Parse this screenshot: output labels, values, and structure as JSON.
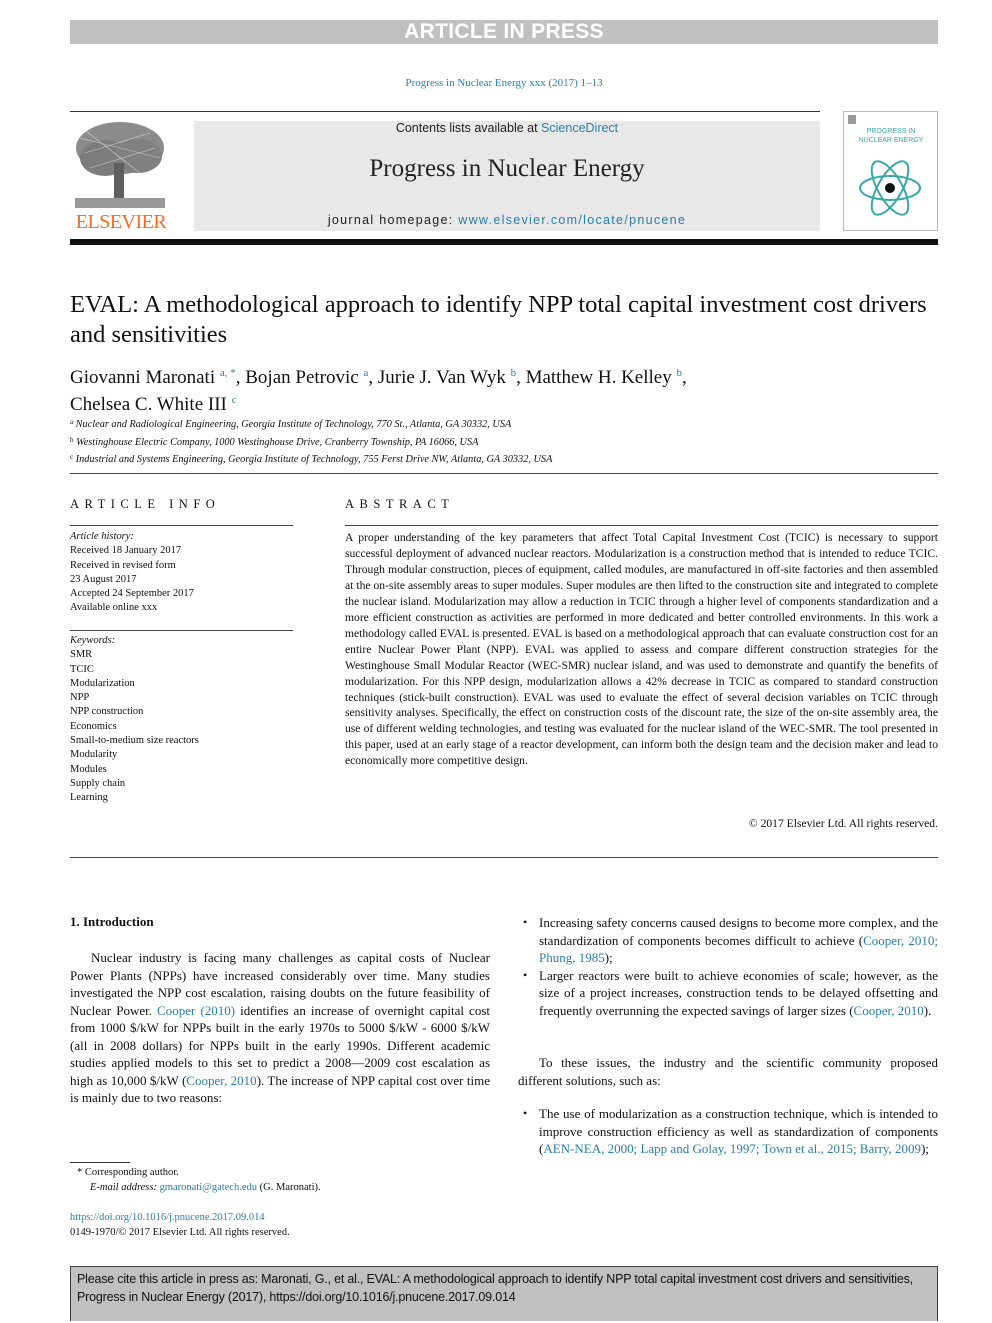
{
  "banner": {
    "article_in_press": "ARTICLE IN PRESS"
  },
  "journal_ref": "Progress in Nuclear Energy xxx (2017) 1–13",
  "header": {
    "publisher_logo_text": "ELSEVIER",
    "contents_prefix": "Contents lists available at ",
    "contents_link": "ScienceDirect",
    "journal_name": "Progress in Nuclear Energy",
    "homepage_prefix": "journal homepage: ",
    "homepage_link": "www.elsevier.com/locate/pnucene",
    "cover_title_line1": "PROGRESS IN",
    "cover_title_line2": "NUCLEAR ENERGY"
  },
  "article": {
    "title": "EVAL: A methodological approach to identify NPP total capital investment cost drivers and sensitivities",
    "authors": [
      {
        "name": "Giovanni Maronati",
        "sup": "a, *",
        "sep": ", "
      },
      {
        "name": "Bojan Petrovic",
        "sup": "a",
        "sep": ", "
      },
      {
        "name": "Jurie J. Van Wyk",
        "sup": "b",
        "sep": ", "
      },
      {
        "name": "Matthew H. Kelley",
        "sup": "b",
        "sep": ","
      },
      {
        "name": "Chelsea C. White III",
        "sup": "c",
        "sep": ""
      }
    ],
    "affiliations": [
      {
        "key": "a",
        "text": "Nuclear and Radiological Engineering, Georgia Institute of Technology, 770 St., Atlanta, GA 30332, USA"
      },
      {
        "key": "b",
        "text": "Westinghouse Electric Company, 1000 Westinghouse Drive, Cranberry Township, PA 16066, USA"
      },
      {
        "key": "c",
        "text": "Industrial and Systems Engineering, Georgia Institute of Technology, 755 Ferst Drive NW, Atlanta, GA 30332, USA"
      }
    ]
  },
  "article_info": {
    "heading": "ARTICLE INFO",
    "history_label": "Article history:",
    "history": [
      "Received 18 January 2017",
      "Received in revised form",
      "23 August 2017",
      "Accepted 24 September 2017",
      "Available online xxx"
    ],
    "keywords_label": "Keywords:",
    "keywords": [
      "SMR",
      "TCIC",
      "Modularization",
      "NPP",
      "NPP construction",
      "Economics",
      "Small-to-medium size reactors",
      "Modularity",
      "Modules",
      "Supply chain",
      "Learning"
    ]
  },
  "abstract": {
    "heading": "ABSTRACT",
    "text": "A proper understanding of the key parameters that affect Total Capital Investment Cost (TCIC) is necessary to support successful deployment of advanced nuclear reactors. Modularization is a construction method that is intended to reduce TCIC. Through modular construction, pieces of equipment, called modules, are manufactured in off-site factories and then assembled at the on-site assembly areas to super modules. Super modules are then lifted to the construction site and integrated to complete the nuclear island. Modularization may allow a reduction in TCIC through a higher level of components standardization and a more efficient construction as activities are performed in more dedicated and better controlled environments. In this work a methodology called EVAL is presented. EVAL is based on a methodological approach that can evaluate construction cost for an entire Nuclear Power Plant (NPP). EVAL was applied to assess and compare different construction strategies for the Westinghouse Small Modular Reactor (WEC-SMR) nuclear island, and was used to demonstrate and quantify the benefits of modularization. For this NPP design, modularization allows a 42% decrease in TCIC as compared to standard construction techniques (stick-built construction). EVAL was used to evaluate the effect of several decision variables on TCIC through sensitivity analyses. Specifically, the effect on construction costs of the discount rate, the size of the on-site assembly area, the use of different welding technologies, and testing was evaluated for the nuclear island of the WEC-SMR. The tool presented in this paper, used at an early stage of a reactor development, can inform both the design team and the decision maker and lead to economically more competitive design.",
    "copyright": "© 2017 Elsevier Ltd. All rights reserved."
  },
  "introduction": {
    "heading": "1.  Introduction",
    "para1": [
      {
        "t": "Nuclear industry is facing many challenges as capital costs of Nuclear Power Plants (NPPs) have increased considerably over time. Many studies investigated the NPP cost escalation, raising doubts on the future feasibility of Nuclear Power. "
      },
      {
        "t": "Cooper (2010)",
        "link": true
      },
      {
        "t": " identifies an increase of overnight capital cost from 1000 $/kW for NPPs built in the early 1970s to 5000 $/kW - 6000 $/kW (all in 2008 dollars) for NPPs built in the early 1990s. Different academic studies applied models to this set to predict a 2008—2009 cost escalation as high as 10,000 $/kW ("
      },
      {
        "t": "Cooper, 2010",
        "link": true
      },
      {
        "t": "). The increase of NPP capital cost over time is mainly due to two reasons:"
      }
    ],
    "bullets1": [
      [
        {
          "t": "Increasing safety concerns caused designs to become more complex, and the standardization of components becomes difficult to achieve ("
        },
        {
          "t": "Cooper, 2010; Phung, 1985",
          "link": true
        },
        {
          "t": ");"
        }
      ],
      [
        {
          "t": "Larger reactors were built to achieve economies of scale; however, as the size of a project increases, construction tends to be delayed offsetting and frequently overrunning the expected savings of larger sizes ("
        },
        {
          "t": "Cooper, 2010",
          "link": true
        },
        {
          "t": ")."
        }
      ]
    ],
    "para2": "To these issues, the industry and the scientific community proposed different solutions, such as:",
    "bullets2": [
      [
        {
          "t": "The use of modularization as a construction technique, which is intended to improve construction efficiency as well as standardization of components ("
        },
        {
          "t": "AEN-NEA, 2000; Lapp and Golay, 1997; Town et al., 2015; Barry, 2009",
          "link": true
        },
        {
          "t": ");"
        }
      ]
    ]
  },
  "footnote": {
    "corresponding": "* Corresponding author.",
    "email_label": "E-mail address: ",
    "email": "gmaronati@gatech.edu",
    "email_suffix": " (G. Maronati)."
  },
  "doi": {
    "link": "https://doi.org/10.1016/j.pnucene.2017.09.014",
    "issn_copyright": "0149-1970/© 2017 Elsevier Ltd. All rights reserved."
  },
  "cite_box": "Please cite this article in press as: Maronati, G., et al., EVAL: A methodological approach to identify NPP total capital investment cost drivers and sensitivities, Progress in Nuclear Energy (2017), https://doi.org/10.1016/j.pnucene.2017.09.014",
  "colors": {
    "link": "#2a7fa8",
    "elsevier_orange": "#f26b21",
    "press_bar": "#c0c0c0",
    "cover_teal": "#3aa6a6"
  }
}
